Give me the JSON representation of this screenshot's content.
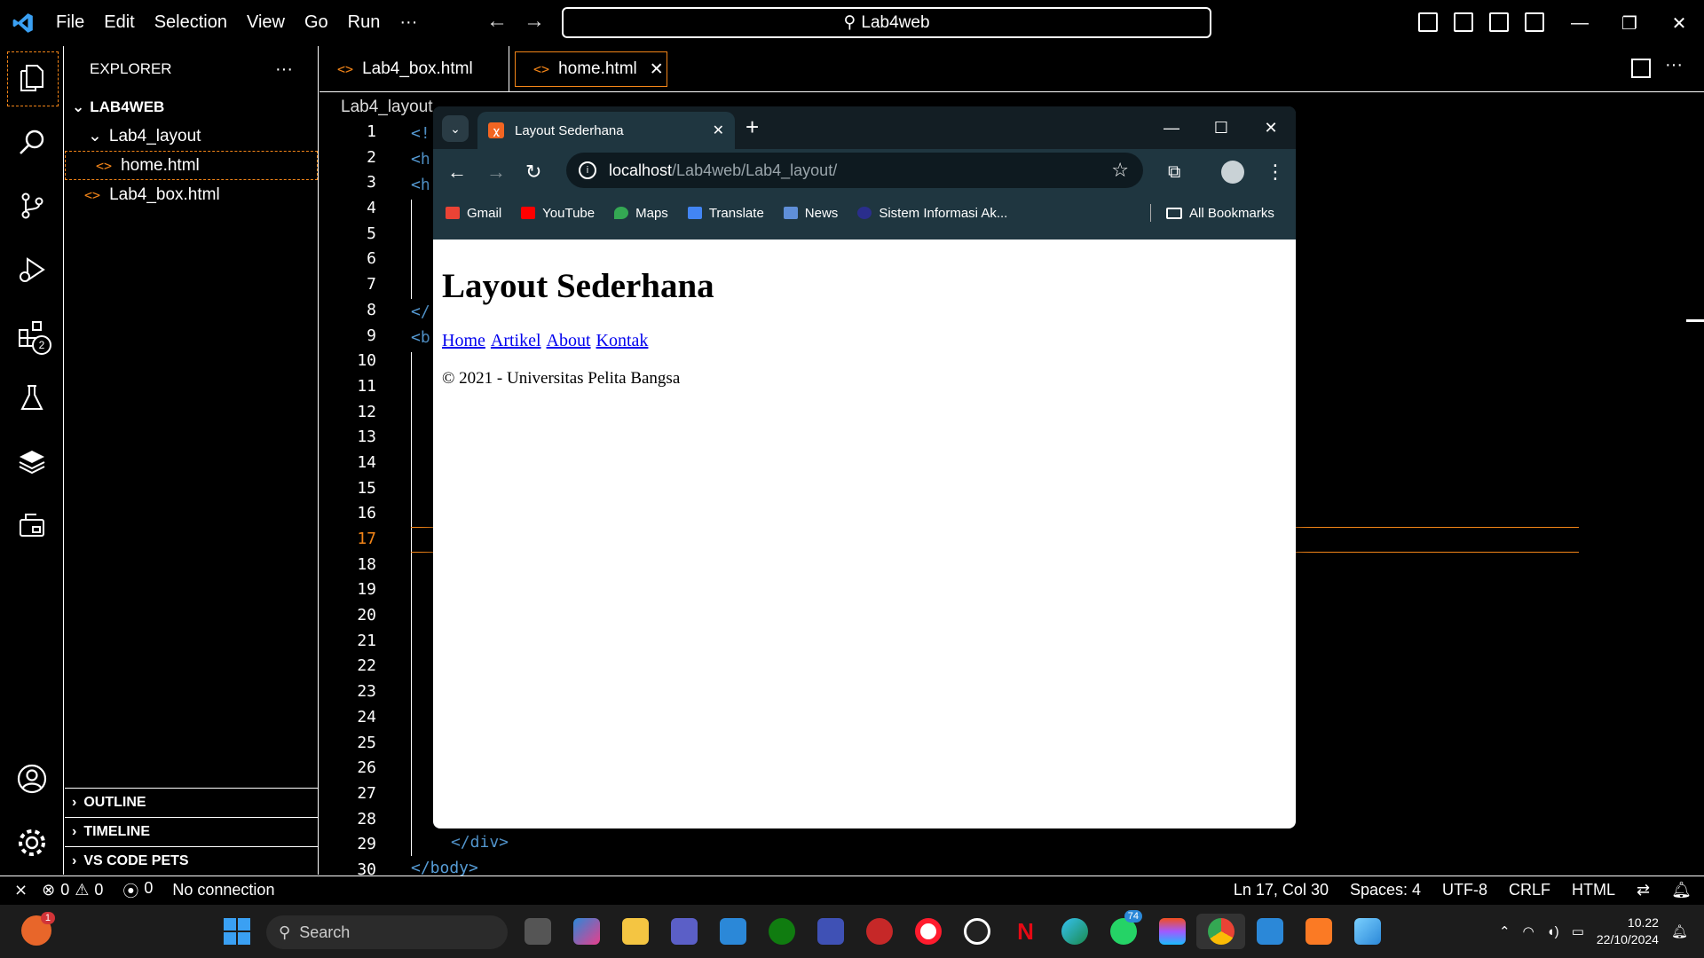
{
  "titlebar": {
    "menu": [
      "File",
      "Edit",
      "Selection",
      "View",
      "Go",
      "Run",
      "···"
    ],
    "command_center": "Lab4web"
  },
  "sidebar": {
    "header": "EXPLORER",
    "more": "···",
    "root": "LAB4WEB",
    "folder": "Lab4_layout",
    "files": [
      "home.html",
      "Lab4_box.html"
    ],
    "sections": [
      "OUTLINE",
      "TIMELINE",
      "VS CODE PETS"
    ],
    "extensions_badge": "2"
  },
  "editor": {
    "tabs": [
      "Lab4_box.html",
      "home.html"
    ],
    "breadcrumb_root": "Lab4_layout",
    "line_numbers": [
      "1",
      "2",
      "3",
      "4",
      "5",
      "6",
      "7",
      "8",
      "9",
      "10",
      "11",
      "12",
      "13",
      "14",
      "15",
      "16",
      "17",
      "18",
      "19",
      "20",
      "21",
      "22",
      "23",
      "24",
      "25",
      "26",
      "27",
      "28",
      "29",
      "30"
    ],
    "current_line": "17",
    "visible_code": {
      "l1": "<!",
      "l2": "<h",
      "l3": "<h",
      "l8": "</",
      "l9": "<b",
      "l29": "</div>",
      "l30": "</body>"
    }
  },
  "browser": {
    "tab_title": "Layout Sederhana",
    "url_host": "localhost",
    "url_path": "/Lab4web/Lab4_layout/",
    "bookmarks": [
      "Gmail",
      "YouTube",
      "Maps",
      "Translate",
      "News",
      "Sistem Informasi Ak..."
    ],
    "all_bookmarks": "All Bookmarks",
    "page": {
      "heading": "Layout Sederhana",
      "nav": [
        "Home",
        "Artikel",
        "About",
        "Kontak"
      ],
      "footer": "© 2021 - Universitas Pelita Bangsa"
    }
  },
  "statusbar": {
    "problems_errors": "0",
    "problems_warnings": "0",
    "ports": "0",
    "connection": "No connection",
    "position": "Ln 17, Col 30",
    "spaces": "Spaces: 4",
    "encoding": "UTF-8",
    "eol": "CRLF",
    "language": "HTML"
  },
  "taskbar": {
    "search_placeholder": "Search",
    "notification_badge": "1",
    "whatsapp_badge": "74",
    "time": "10.22",
    "date": "22/10/2024"
  },
  "colors": {
    "accent_orange": "#f38518",
    "browser_frame": "#1f3640",
    "link_blue": "#0000ee"
  }
}
